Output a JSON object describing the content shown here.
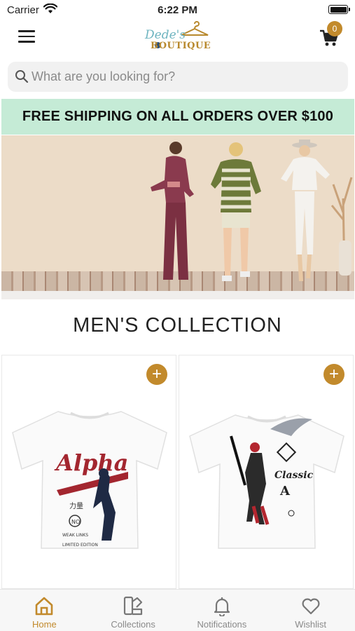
{
  "status_bar": {
    "carrier": "Carrier",
    "time": "6:22 PM"
  },
  "header": {
    "logo_script": "Dede's",
    "logo_word": "BOUTIQUE",
    "cart_count": "0"
  },
  "search": {
    "placeholder": "What are you looking for?"
  },
  "promo": {
    "text": "FREE SHIPPING ON ALL ORDERS OVER $100"
  },
  "section": {
    "title": "MEN'S COLLECTION"
  },
  "products": [
    {
      "add_label": "+",
      "shirt_text": "Alpha"
    },
    {
      "add_label": "+",
      "shirt_text": "Classic"
    }
  ],
  "tabs": [
    {
      "label": "Home",
      "icon": "home-icon",
      "active": true
    },
    {
      "label": "Collections",
      "icon": "collections-icon",
      "active": false
    },
    {
      "label": "Notifications",
      "icon": "bell-icon",
      "active": false
    },
    {
      "label": "Wishlist",
      "icon": "heart-icon",
      "active": false
    }
  ],
  "colors": {
    "accent": "#c28a2c",
    "promo_bg": "#c5ebd6"
  }
}
